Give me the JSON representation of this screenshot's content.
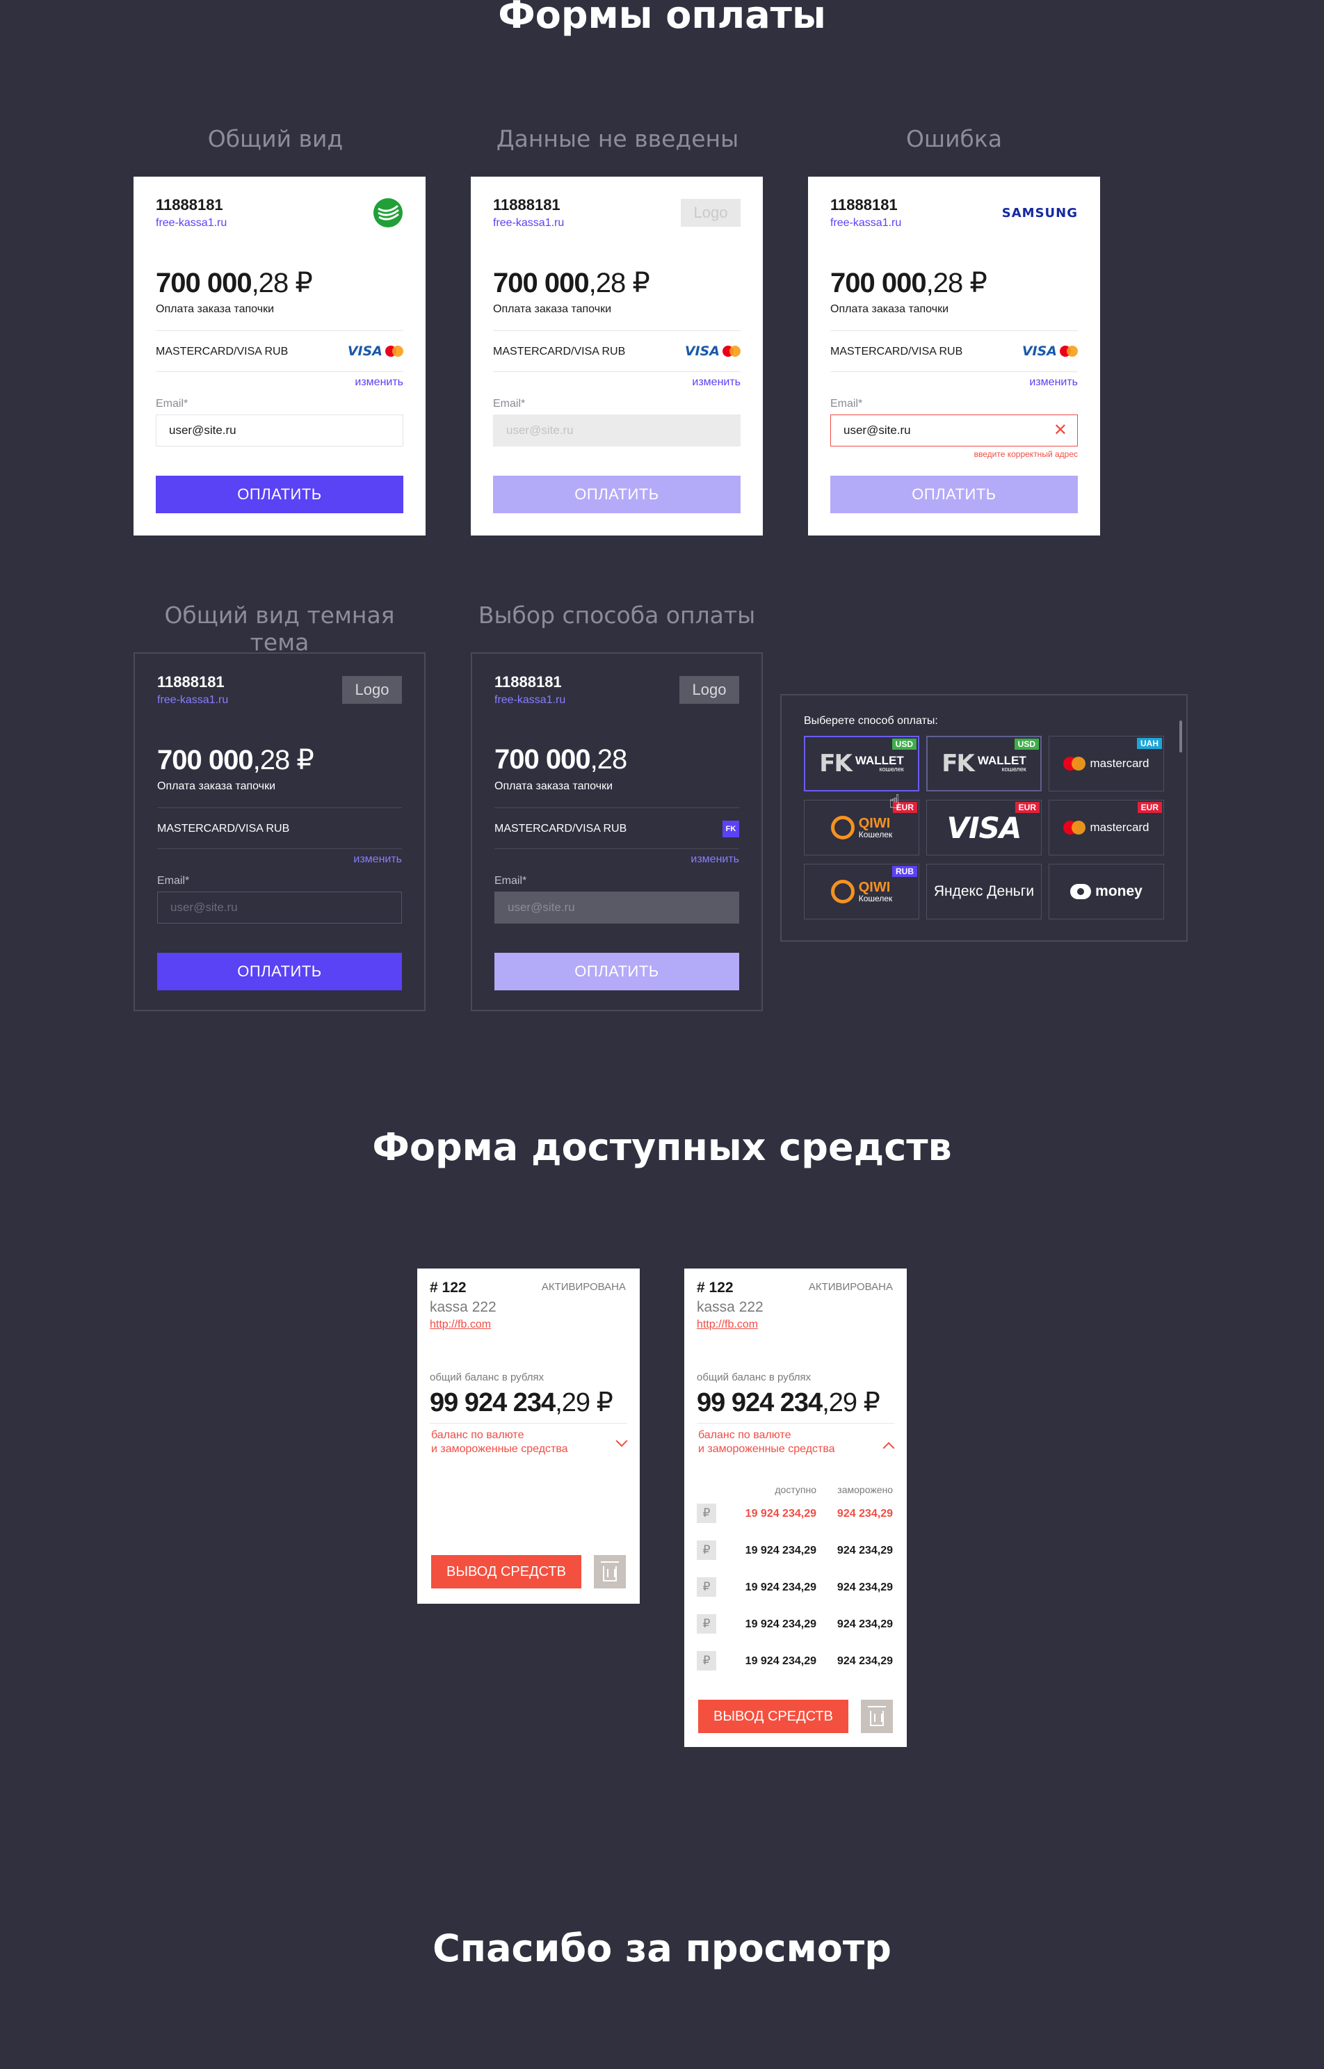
{
  "sections": {
    "payment_forms_title": "Формы оплаты",
    "funds_form_title": "Форма доступных средств",
    "thanks_title": "Спасибо за просмотр"
  },
  "labels": {
    "general": "Общий вид",
    "empty": "Данные не введены",
    "error": "Ошибка",
    "dark": "Общий вид темная тема",
    "choose": "Выбор способа оплаты"
  },
  "card": {
    "number": "11888181",
    "site": "free-kassa1.ru",
    "amount_int": "700 000",
    "amount_frac": ",28 ₽",
    "amount_frac_no_currency": ",28",
    "description": "Оплата заказа тапочки",
    "method": "MASTERCARD/VISA RUB",
    "change": "изменить",
    "email_label": "Email*",
    "email_value": "user@site.ru",
    "email_placeholder": "user@site.ru",
    "error_msg": "введите корректный адрес",
    "pay_button": "ОПЛАТИТЬ",
    "logo_placeholder": "Logo",
    "samsung_logo": "SAMSUNG",
    "visa_mini": "VISA",
    "fk_mini": "FK"
  },
  "picker": {
    "title": "Выберете способ оплаты:",
    "tiles": [
      {
        "name": "WALLET",
        "sub": "кошелек",
        "tag": "USD",
        "tag_color": "#3fae49"
      },
      {
        "name": "WALLET",
        "sub": "кошелек",
        "tag": "USD",
        "tag_color": "#3fae49"
      },
      {
        "name": "mastercard",
        "tag": "UAH",
        "tag_color": "#1ea5d8"
      },
      {
        "name": "QIWI",
        "sub": "Кошелек",
        "tag": "EUR",
        "tag_color": "#e0213a"
      },
      {
        "name": "VISA",
        "tag": "EUR",
        "tag_color": "#e0213a"
      },
      {
        "name": "mastercard",
        "tag": "EUR",
        "tag_color": "#e0213a"
      },
      {
        "name": "QIWI",
        "sub": "Кошелек",
        "tag": "RUB",
        "tag_color": "#5a42f5"
      },
      {
        "name": "Яндекс Деньги",
        "tag": ""
      },
      {
        "name": "money",
        "tag": ""
      }
    ]
  },
  "balance": {
    "num": "# 122",
    "status": "АКТИВИРОВАНА",
    "name": "kassa 222",
    "link": "http://fb.com",
    "caption": "общий баланс в рублях",
    "amount_int": "99 924 234",
    "amount_frac": ",29 ₽",
    "toggle_line1": "баланс по валюте",
    "toggle_line2": "и замороженные средства",
    "withdraw": "ВЫВОД СРЕДСТВ",
    "col_available": "доступно",
    "col_frozen": "заморожено",
    "rows": [
      {
        "cur": "₽",
        "available": "19 924 234,29",
        "frozen": "924 234,29"
      },
      {
        "cur": "₽",
        "available": "19 924 234,29",
        "frozen": "924 234,29"
      },
      {
        "cur": "₽",
        "available": "19 924 234,29",
        "frozen": "924 234,29"
      },
      {
        "cur": "₽",
        "available": "19 924 234,29",
        "frozen": "924 234,29"
      },
      {
        "cur": "₽",
        "available": "19 924 234,29",
        "frozen": "924 234,29"
      }
    ]
  },
  "colors": {
    "background": "#30303f",
    "accent": "#5a42f5",
    "accent_disabled": "#b3aaf8",
    "error": "#f04d44",
    "withdraw": "#f4503f"
  }
}
